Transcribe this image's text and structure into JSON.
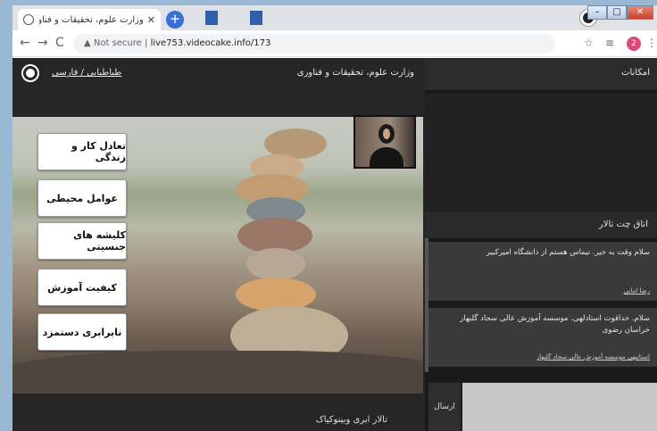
{
  "browser": {
    "tab_title": "وزارت علوم، تحقیقات و فناوری",
    "tab_close": "✕",
    "new_tab": "+",
    "back": "←",
    "forward": "→",
    "reload": "C",
    "security_label": "Not secure",
    "url": "live753.videocake.info/173",
    "star": "☆",
    "profile_initial": "2",
    "menu": "⋮",
    "win_min": "–",
    "win_max": "□",
    "win_close": "✕"
  },
  "header": {
    "org_name": "وزارت علوم، تحقیقات و فناوری",
    "language_link": "طباطبایی / فارسی"
  },
  "slide": {
    "items": [
      "تعادل کار و زندگی",
      "عوامل محیطی",
      "کلیشه های جنسیتی",
      "کیفیت آموزش",
      "نابرابری دستمزد"
    ]
  },
  "footer": {
    "hall_name": "تالار ابری وبینوکیاک"
  },
  "sidebar": {
    "title": "امکانات",
    "chat_title": "اتاق چت تالار",
    "messages": [
      {
        "text": "سلام وقت به خیر. نیماس هستم از دانشگاه امیرکبیر",
        "meta": "رضا امانی"
      },
      {
        "text": "سلام. خداقوت استادلهی. موسسه آموزش عالی سجاد گلبهار خراسان رضوی",
        "meta": "استاتیهی موسسه آموزش عالی سجاد گلبهار"
      }
    ],
    "send_label": "ارسال"
  },
  "colors": {
    "page_bg": "#1e1e1e",
    "panel_bg": "#262626",
    "message_bg": "#3a3a3a",
    "accent_tab": "#3b6fd4"
  }
}
